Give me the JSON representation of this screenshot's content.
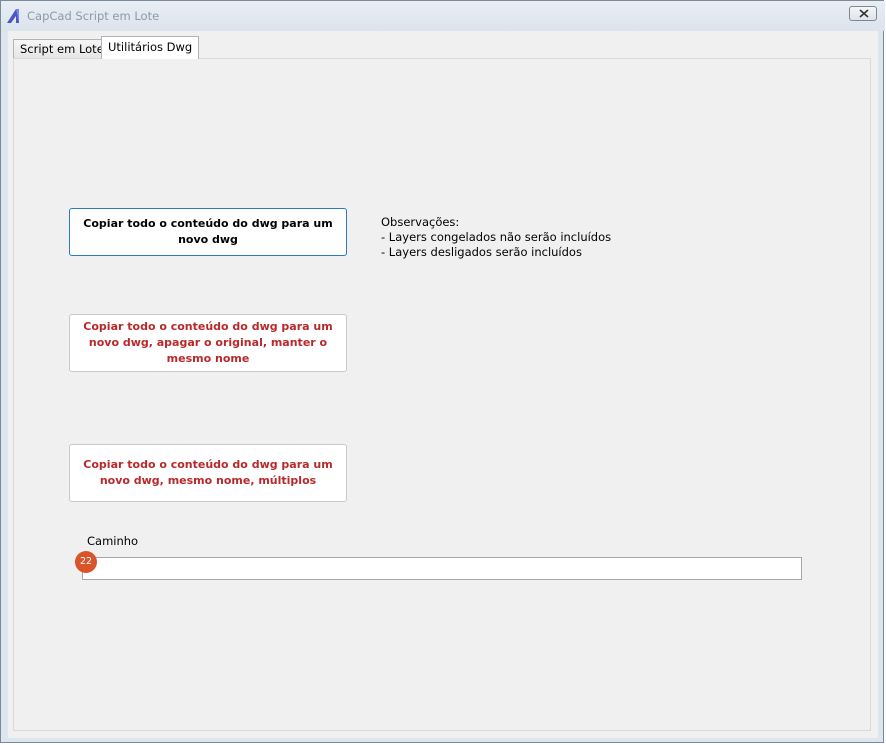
{
  "window": {
    "title": "CapCad Script em Lote"
  },
  "tabs": [
    {
      "label": "Script em Lote",
      "active": false
    },
    {
      "label": "Utilitários Dwg",
      "active": true
    }
  ],
  "buttons": [
    {
      "label": "Copiar todo o conteúdo do dwg para um novo dwg",
      "color": "#000000"
    },
    {
      "label": "Copiar todo o conteúdo do dwg para um novo dwg, apagar o original, manter o mesmo nome",
      "color": "#b8292b"
    },
    {
      "label": "Copiar todo o conteúdo do dwg para um novo dwg, mesmo nome, múltiplos",
      "color": "#b8292b"
    }
  ],
  "notes": {
    "heading": "Observações:",
    "lines": [
      "- Layers congelados não serão incluídos",
      "- Layers desligados serão incluídos"
    ]
  },
  "path": {
    "label": "Caminho",
    "value": "",
    "badge": "22"
  },
  "colors": {
    "accent": "#2b7bc4",
    "warning_text": "#b8292b",
    "badge": "#d9542b"
  },
  "icons": {
    "app": "capcad-logo-icon",
    "close": "close-icon"
  }
}
